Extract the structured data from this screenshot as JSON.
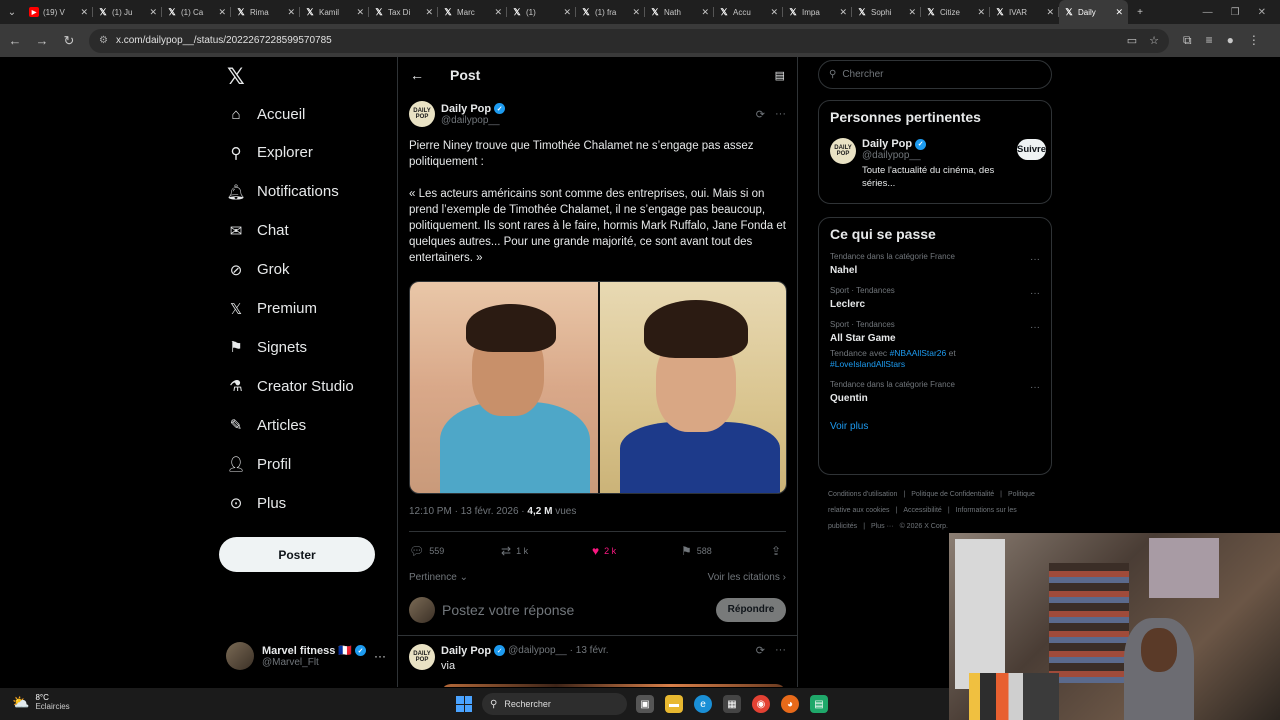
{
  "browser": {
    "tabs": [
      {
        "icon": "youtube-icon",
        "title": "(19) V"
      },
      {
        "icon": "x-icon",
        "title": "(1) Ju"
      },
      {
        "icon": "x-icon",
        "title": "(1) Ca"
      },
      {
        "icon": "x-icon",
        "title": "Rima"
      },
      {
        "icon": "x-icon",
        "title": "Kamil"
      },
      {
        "icon": "x-icon",
        "title": "Tax Di"
      },
      {
        "icon": "x-icon",
        "title": "Marc"
      },
      {
        "icon": "x-icon",
        "title": "(1)"
      },
      {
        "icon": "x-icon",
        "title": "(1) fra"
      },
      {
        "icon": "x-icon",
        "title": "Nath"
      },
      {
        "icon": "x-icon",
        "title": "Accu"
      },
      {
        "icon": "x-icon",
        "title": "Impa"
      },
      {
        "icon": "x-icon",
        "title": "Sophi"
      },
      {
        "icon": "x-icon",
        "title": "Citize"
      },
      {
        "icon": "x-icon",
        "title": "IVAR"
      },
      {
        "icon": "x-icon",
        "title": "Daily",
        "active": true
      }
    ],
    "url": "x.com/dailypop__/status/2022267228599570785"
  },
  "nav": {
    "items": [
      {
        "label": "Accueil",
        "icon": "home-icon"
      },
      {
        "label": "Explorer",
        "icon": "search-icon"
      },
      {
        "label": "Notifications",
        "icon": "bell-icon"
      },
      {
        "label": "Chat",
        "icon": "mail-icon"
      },
      {
        "label": "Grok",
        "icon": "grok-icon"
      },
      {
        "label": "Premium",
        "icon": "x-premium-icon"
      },
      {
        "label": "Signets",
        "icon": "bookmark-icon"
      },
      {
        "label": "Creator Studio",
        "icon": "flask-icon"
      },
      {
        "label": "Articles",
        "icon": "article-icon"
      },
      {
        "label": "Profil",
        "icon": "person-icon"
      },
      {
        "label": "Plus",
        "icon": "more-circle-icon"
      }
    ],
    "post_button": "Poster",
    "account": {
      "name": "Marvel fitness",
      "flag": "🇫🇷",
      "handle": "@Marvel_Flt"
    }
  },
  "main": {
    "header_title": "Post",
    "post": {
      "author": "Daily Pop",
      "handle": "@dailypop__",
      "avatar_text": "DAILY POP",
      "text_1": "Pierre Niney trouve que Timothée Chalamet ne s’engage pas assez politiquement :",
      "text_2": "« Les acteurs américains sont comme des entreprises, oui. Mais si on prend l’exemple de Timothée Chalamet, il ne s’engage pas beaucoup, politiquement. Ils sont rares à le faire, hormis Mark Ruffalo, Jane Fonda et quelques autres... Pour une grande majorité, ce sont avant tout des entertainers. »",
      "timestamp": "12:10 PM · 13 févr. 2026 ·",
      "views": "4,2 M",
      "views_label": "vues",
      "replies": "559",
      "reposts": "1 k",
      "likes": "2 k",
      "bookmarks": "588"
    },
    "sort_label": "Pertinence",
    "quotes_label": "Voir les citations",
    "reply_placeholder": "Postez votre réponse",
    "reply_button": "Répondre",
    "next_tweet": {
      "author": "Daily Pop",
      "handle": "@dailypop__",
      "date": "· 13 févr.",
      "text": "via"
    }
  },
  "right": {
    "search_placeholder": "Chercher",
    "relevant": {
      "title": "Personnes pertinentes",
      "name": "Daily Pop",
      "handle": "@dailypop__",
      "bio": "Toute l'actualité du cinéma, des séries...",
      "follow": "Suivre"
    },
    "trends": {
      "title": "Ce qui se passe",
      "items": [
        {
          "context": "Tendance dans la catégorie France",
          "name": "Nahel"
        },
        {
          "context": "Sport · Tendances",
          "name": "Leclerc"
        },
        {
          "context": "Sport · Tendances",
          "name": "All Star Game",
          "with_prefix": "Tendance avec",
          "tag1": "#NBAAllStar26",
          "and": "et",
          "tag2": "#LoveIslandAllStars"
        },
        {
          "context": "Tendance dans la catégorie France",
          "name": "Quentin"
        }
      ],
      "see_more": "Voir plus"
    },
    "footer": [
      "Conditions d'utilisation",
      "|",
      "Politique de Confidentialité",
      "|",
      "Politique relative aux cookies",
      "|",
      "Accessibilité",
      "|",
      "Informations sur les publicités",
      "|",
      "Plus ···",
      "© 2026 X Corp."
    ]
  },
  "taskbar": {
    "temp": "8°C",
    "weather": "Eclaircies",
    "search_label": "Rechercher"
  },
  "colors": {
    "accent": "#1d9bf0",
    "like": "#f91880"
  }
}
